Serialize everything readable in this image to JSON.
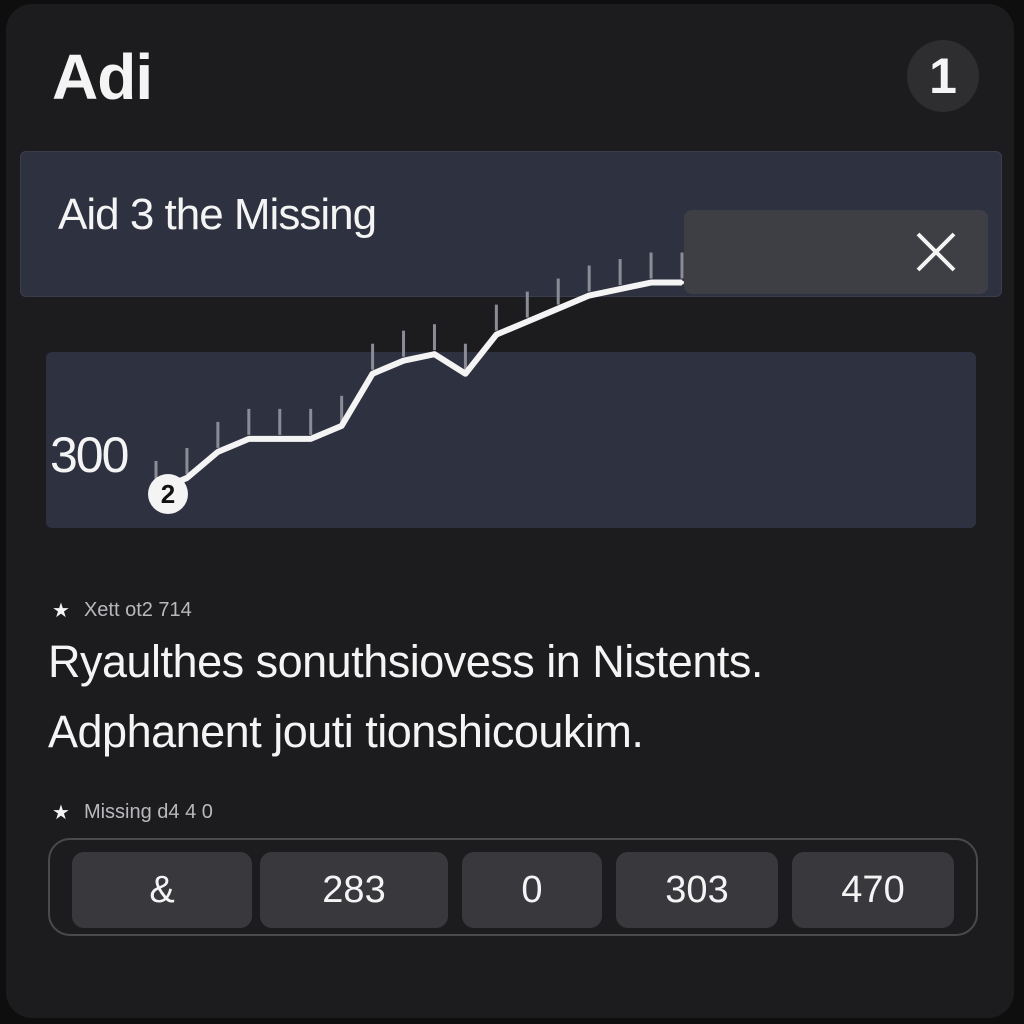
{
  "header": {
    "title": "Adi",
    "badge_count": "1"
  },
  "search": {
    "value": "Aid 3 the Missing",
    "close_icon": "close-icon"
  },
  "chart": {
    "value_label": "300",
    "marker_label": "2",
    "line_color": "#f4f4f4",
    "background": "#2e3140"
  },
  "chart_data": {
    "type": "line",
    "series": [
      {
        "values": [
          290,
          300,
          320,
          330,
          330,
          330,
          340,
          380,
          390,
          395,
          380,
          410,
          420,
          430,
          440,
          445,
          450,
          450
        ]
      }
    ]
  },
  "section1": {
    "meta": "Xett ot2 714",
    "line1": "Ryaulthes sonuthsiovess  in Nistents.",
    "line2": "Adphanent  jouti tionshicoukim."
  },
  "section2": {
    "meta": "Missing d4 4  0"
  },
  "values": [
    "&",
    "283",
    "0",
    "303",
    "470"
  ],
  "colors": {
    "background": "#1c1c1e",
    "accent": "#2e3140",
    "chip": "#39393d"
  }
}
